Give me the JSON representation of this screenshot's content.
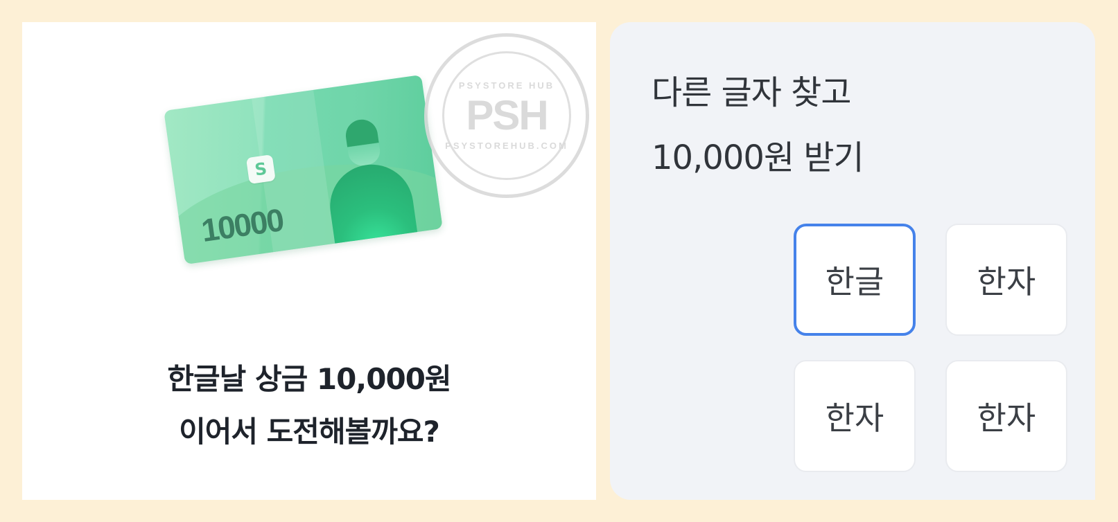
{
  "promo": {
    "card_value": "10000",
    "card_logo": "S",
    "headline_line1": "한글날 상금 10,000원",
    "headline_line2": "이어서 도전해볼까요?"
  },
  "watermark": {
    "top_text": "PSYSTORE HUB",
    "mark": "PSH",
    "bottom_text": "PSYSTOREHUB.COM"
  },
  "quiz": {
    "title_line1": "다른 글자 찾고",
    "title_line2": "10,000원 받기",
    "options": [
      "한글",
      "한자",
      "한자",
      "한자"
    ],
    "selected_index": 0
  },
  "colors": {
    "page_background": "#fdf0d6",
    "selected_border": "#4582ea",
    "card_green": "#6fd5a9"
  }
}
